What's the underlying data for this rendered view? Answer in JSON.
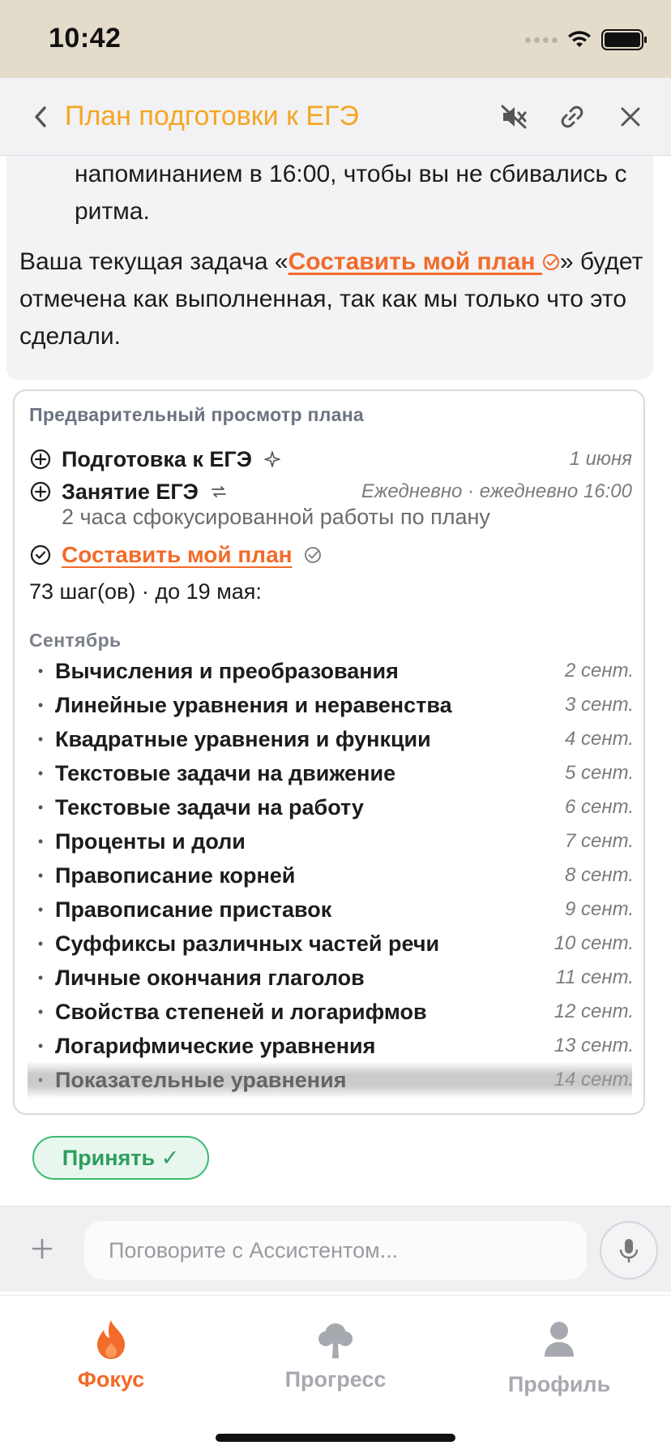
{
  "status_bar": {
    "time": "10:42"
  },
  "header": {
    "title": "План подготовки к ЕГЭ",
    "icons": [
      "back-chevron-icon",
      "mute-icon",
      "link-icon",
      "close-icon"
    ],
    "accent_color": "#f5a623"
  },
  "chat": {
    "prev_text": "напоминанием в 16:00, чтобы вы не сбивались с ритма.",
    "main_text_before": "Ваша текущая задача «",
    "task_link": "Составить мой план",
    "main_text_after": "» будет отмечена как выполненная, так как мы только что это сделали."
  },
  "plan_preview": {
    "header": "Предварительный просмотр плана",
    "goals": [
      {
        "name": "Подготовка к ЕГЭ",
        "date": "1 июня",
        "icon": "add-circle-icon",
        "aux_icon": "sparkle-icon"
      },
      {
        "name": "Занятие ЕГЭ",
        "date": "Ежедневно · ежедневно 16:00",
        "icon": "add-circle-icon",
        "aux_icon": "repeat-icon",
        "subtitle": "2 часа сфокусированной работы по плану"
      }
    ],
    "task": {
      "name": "Составить мой план",
      "icon": "check-circle-icon"
    },
    "steps_summary": "73 шаг(ов) · до 19 мая:",
    "month": "Сентябрь",
    "steps": [
      {
        "name": "Вычисления и преобразования",
        "date": "2 сент."
      },
      {
        "name": "Линейные уравнения и неравенства",
        "date": "3 сент."
      },
      {
        "name": "Квадратные уравнения и функции",
        "date": "4 сент."
      },
      {
        "name": "Текстовые задачи на движение",
        "date": "5 сент."
      },
      {
        "name": "Текстовые задачи на работу",
        "date": "6 сент."
      },
      {
        "name": "Проценты и доли",
        "date": "7 сент."
      },
      {
        "name": "Правописание корней",
        "date": "8 сент."
      },
      {
        "name": "Правописание приставок",
        "date": "9 сент."
      },
      {
        "name": "Суффиксы различных частей речи",
        "date": "10 сент."
      },
      {
        "name": "Личные окончания глаголов",
        "date": "11 сент."
      },
      {
        "name": "Свойства степеней и логарифмов",
        "date": "12 сент."
      },
      {
        "name": "Логарифмические уравнения",
        "date": "13 сент."
      },
      {
        "name": "Показательные уравнения",
        "date": "14 сент."
      }
    ]
  },
  "accept_button": {
    "label": "Принять ✓",
    "color": "#3cbb72"
  },
  "composer": {
    "placeholder": "Поговорите с Ассистентом..."
  },
  "tabs": [
    {
      "label": "Фокус",
      "icon": "flame-icon",
      "active": true,
      "color": "#f26b2a"
    },
    {
      "label": "Прогресс",
      "icon": "tree-icon",
      "active": false,
      "color": "#a7a9b0"
    },
    {
      "label": "Профиль",
      "icon": "person-icon",
      "active": false,
      "color": "#a7a9b0"
    }
  ]
}
